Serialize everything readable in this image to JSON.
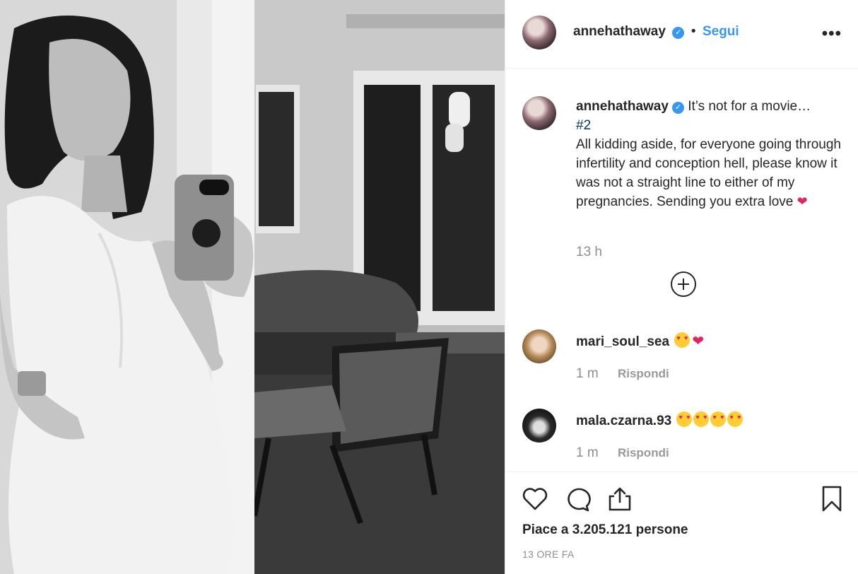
{
  "post": {
    "username": "annehathaway",
    "verified": true,
    "separator": "•",
    "follow_label": "Segui",
    "more_label": "•••"
  },
  "caption": {
    "username": "annehathaway",
    "text": "It’s not for a movie…",
    "hashtag": "#2",
    "body": "All kidding aside, for everyone going through infertility and conception hell, please know it was not a straight line to either of my pregnancies. Sending you extra love",
    "heart": "❤",
    "time": "13 h"
  },
  "comments": [
    {
      "username": "mari_soul_sea",
      "emoji_count": 1,
      "heart": "❤",
      "time": "1 m",
      "reply_label": "Rispondi"
    },
    {
      "username": "mala.czarna.93",
      "emoji_count": 4,
      "heart": "",
      "time": "1 m",
      "reply_label": "Rispondi"
    }
  ],
  "footer": {
    "likes_text": "Piace a 3.205.121 persone",
    "post_time": "13 ORE FA",
    "icons": [
      "heart-icon",
      "comment-icon",
      "share-icon",
      "bookmark-icon"
    ]
  },
  "colors": {
    "link_blue": "#3897f0",
    "hashtag_blue": "#003569",
    "muted_gray": "#8e8e8e",
    "heart_red": "#e0245e"
  }
}
